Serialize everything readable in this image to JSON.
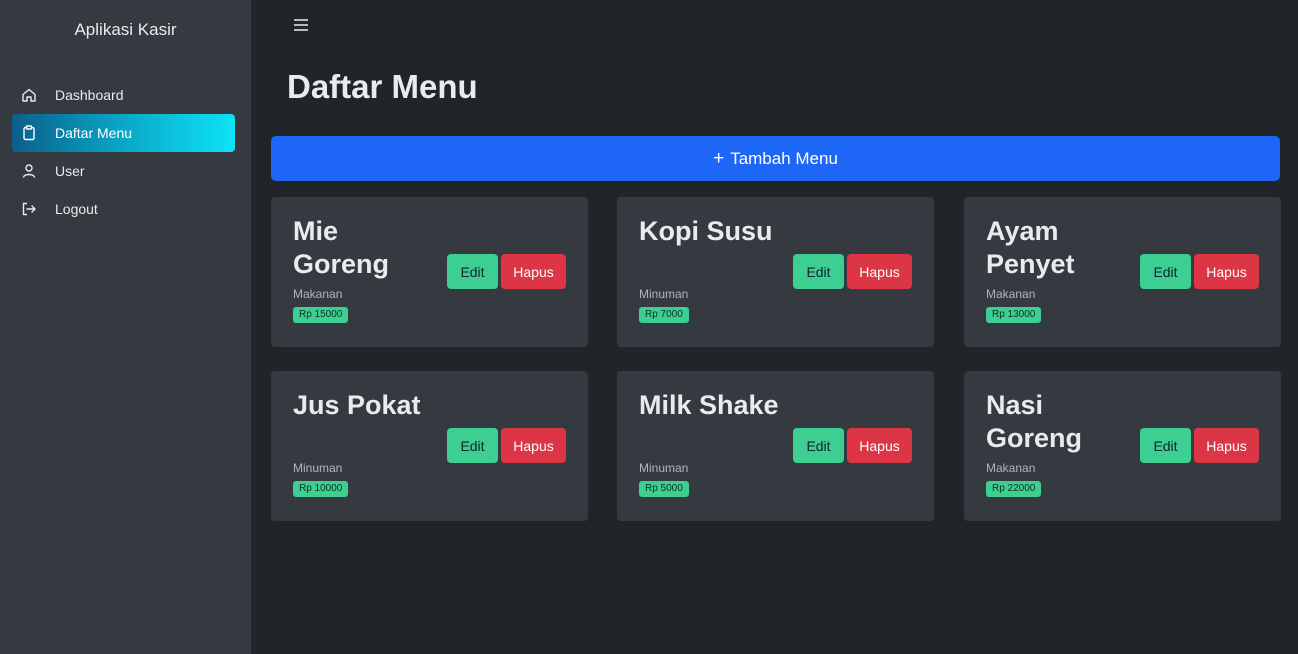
{
  "sidebar": {
    "brand": "Aplikasi Kasir",
    "items": [
      {
        "label": "Dashboard",
        "icon": "home-icon",
        "active": false
      },
      {
        "label": "Daftar Menu",
        "icon": "clipboard-icon",
        "active": true
      },
      {
        "label": "User",
        "icon": "user-icon",
        "active": false
      },
      {
        "label": "Logout",
        "icon": "logout-icon",
        "active": false
      }
    ]
  },
  "header": {
    "menu_icon": "hamburger-icon"
  },
  "main": {
    "title": "Daftar Menu",
    "add_button": {
      "icon": "+",
      "label": "Tambah Menu"
    },
    "cards": [
      {
        "name": "Mie Goreng",
        "category": "Makanan",
        "price": "Rp 15000",
        "edit_label": "Edit",
        "delete_label": "Hapus"
      },
      {
        "name": "Kopi Susu",
        "category": "Minuman",
        "price": "Rp 7000",
        "edit_label": "Edit",
        "delete_label": "Hapus"
      },
      {
        "name": "Ayam Penyet",
        "category": "Makanan",
        "price": "Rp 13000",
        "edit_label": "Edit",
        "delete_label": "Hapus"
      },
      {
        "name": "Jus Pokat",
        "category": "Minuman",
        "price": "Rp 10000",
        "edit_label": "Edit",
        "delete_label": "Hapus"
      },
      {
        "name": "Milk Shake",
        "category": "Minuman",
        "price": "Rp 5000",
        "edit_label": "Edit",
        "delete_label": "Hapus"
      },
      {
        "name": "Nasi Goreng",
        "category": "Makanan",
        "price": "Rp 22000",
        "edit_label": "Edit",
        "delete_label": "Hapus"
      }
    ]
  },
  "colors": {
    "background": "#212529",
    "sidebar": "#343a40",
    "card": "#343a40",
    "primary": "#1e66f5",
    "success": "#3ccf91",
    "danger": "#dc3545",
    "active_gradient_start": "#0b5f8a",
    "active_gradient_end": "#0de3f5"
  }
}
